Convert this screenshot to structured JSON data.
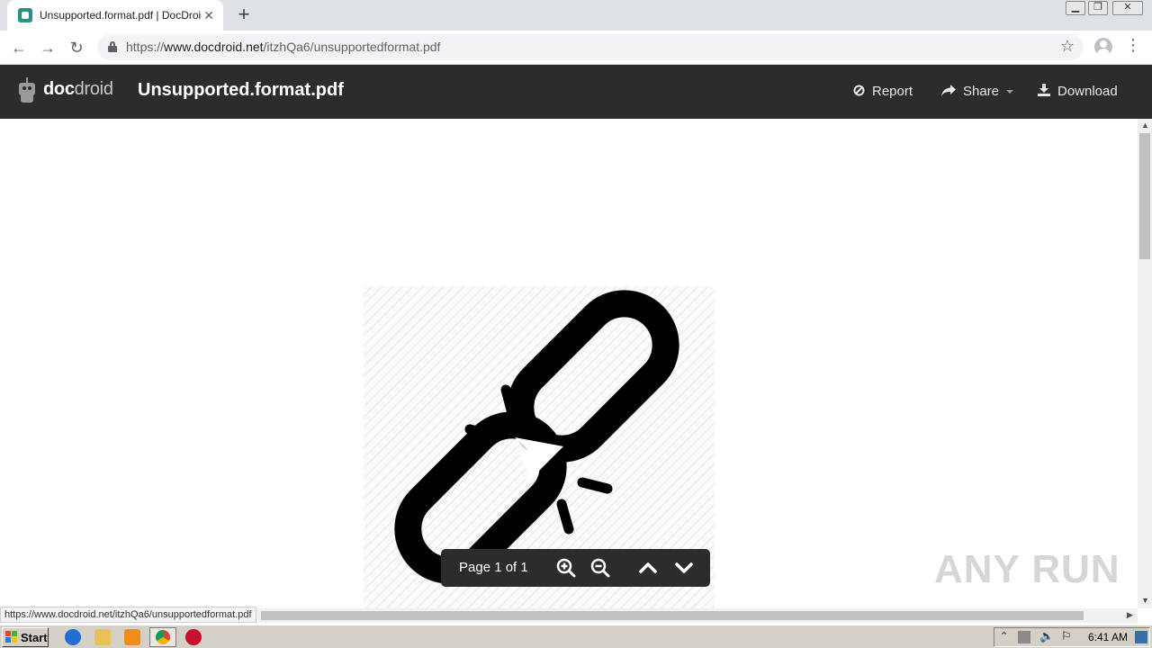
{
  "browser": {
    "tab_title": "Unsupported.format.pdf | DocDroid",
    "tab_close": "✕",
    "new_tab": "+",
    "url_prefix": "https://",
    "url_host": "www.docdroid.net",
    "url_path": "/itzhQa6/unsupportedformat.pdf",
    "status_url": "https://www.docdroid.net/itzhQa6/unsupportedformat.pdf"
  },
  "app": {
    "logo_bold": "doc",
    "logo_light": "droid",
    "doc_title": "Unsupported.format.pdf",
    "actions": {
      "report": "Report",
      "share": "Share",
      "download": "Download"
    }
  },
  "viewer": {
    "page_label": "Page 1 of 1"
  },
  "watermark": "ANY RUN",
  "taskbar": {
    "start": "Start",
    "clock": "6:41 AM"
  },
  "colors": {
    "header_bg": "#2c2c2c",
    "favicon": "#2a8f86"
  }
}
